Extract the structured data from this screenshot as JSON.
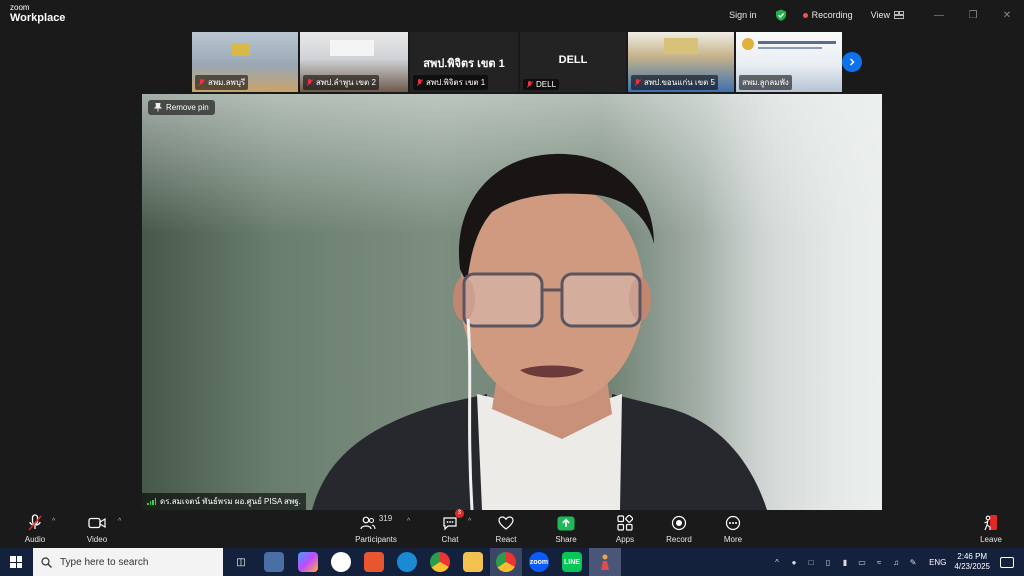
{
  "app": {
    "logo_small": "zoom",
    "logo_large": "Workplace",
    "sign_in": "Sign in",
    "recording": "Recording",
    "view": "View"
  },
  "thumbnails": [
    {
      "name": "สพม.ลพบุรี",
      "muted": true
    },
    {
      "name": "สพป.ลำพูน เขต 2",
      "muted": true
    },
    {
      "name": "สพป.พิจิตร เขต 1",
      "muted": true,
      "big_text": "สพป.พิจิตร เขต 1"
    },
    {
      "name": "DELL",
      "muted": true,
      "big_text": "DELL"
    },
    {
      "name": "สพป.ขอนแก่น เขต 5",
      "muted": true
    },
    {
      "name": "สพม.ลูกลมพัง",
      "muted": false
    }
  ],
  "main_video": {
    "remove_pin": "Remove pin",
    "speaker_name": "ดร.สมเจตน์ พันธ์พรม ผอ.ศูนย์ PISA สพฐ."
  },
  "toolbar": {
    "audio": "Audio",
    "video": "Video",
    "participants": "Participants",
    "participants_count": "319",
    "chat": "Chat",
    "chat_badge": "3",
    "react": "React",
    "share": "Share",
    "apps": "Apps",
    "record": "Record",
    "more": "More",
    "leave": "Leave"
  },
  "taskbar": {
    "search_placeholder": "Type here to search",
    "language": "ENG",
    "time": "2:46 PM",
    "date": "4/23/2025"
  },
  "colors": {
    "accent_blue": "#0e72ed",
    "share_green": "#1fb85a",
    "leave_red": "#e02828",
    "recording_red": "#ff4d4d"
  }
}
